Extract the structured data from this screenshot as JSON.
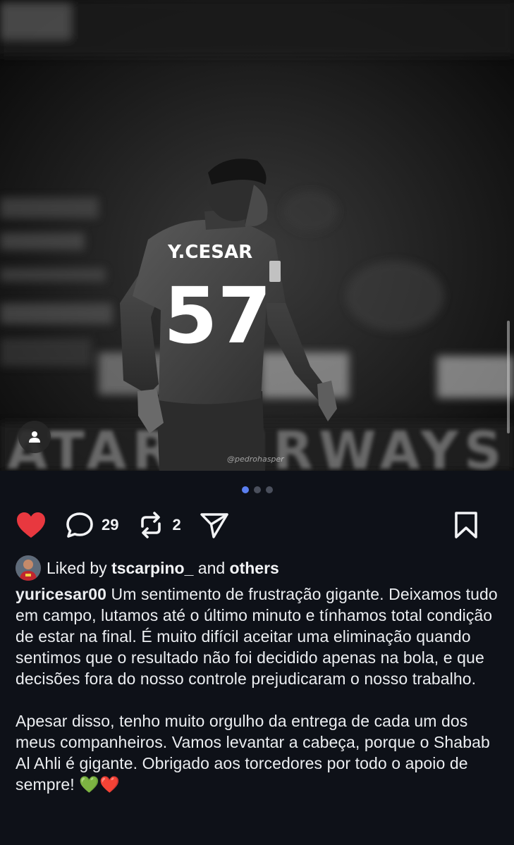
{
  "post": {
    "watermark": "@pedrohasper",
    "carousel": {
      "count": 3,
      "active_index": 0
    },
    "icons": {
      "user_tag": "user-silhouette-icon",
      "like": "heart-filled-icon",
      "comment": "speech-bubble-icon",
      "repost": "repost-arrows-icon",
      "share": "send-plane-icon",
      "bookmark": "bookmark-icon"
    },
    "colors": {
      "like": "#e8383f",
      "active_dot": "#5b7ff0",
      "background": "#0e1118"
    }
  },
  "actions": {
    "comment_count": "29",
    "repost_count": "2"
  },
  "liked_by": {
    "prefix": "Liked by",
    "user": "tscarpino_",
    "connector": "and",
    "others": "others"
  },
  "caption": {
    "username": "yuricesar00",
    "paragraph1": "Um sentimento de frustração gigante. Deixamos tudo em campo, lutamos até o último minuto e tínhamos total condição de estar na final. É muito difícil aceitar uma eliminação quando sentimos que o resultado não foi decidido apenas na bola, e que decisões fora do nosso controle prejudicaram o nosso trabalho.",
    "paragraph2": "Apesar disso, tenho muito orgulho da entrega de cada um dos meus companheiros. Vamos levantar a cabeça, porque o Shabab Al Ahli é gigante. Obrigado aos torcedores por todo o apoio de sempre! 💚❤️"
  },
  "photo": {
    "jersey_name": "Y.CESAR",
    "jersey_number": "57"
  }
}
